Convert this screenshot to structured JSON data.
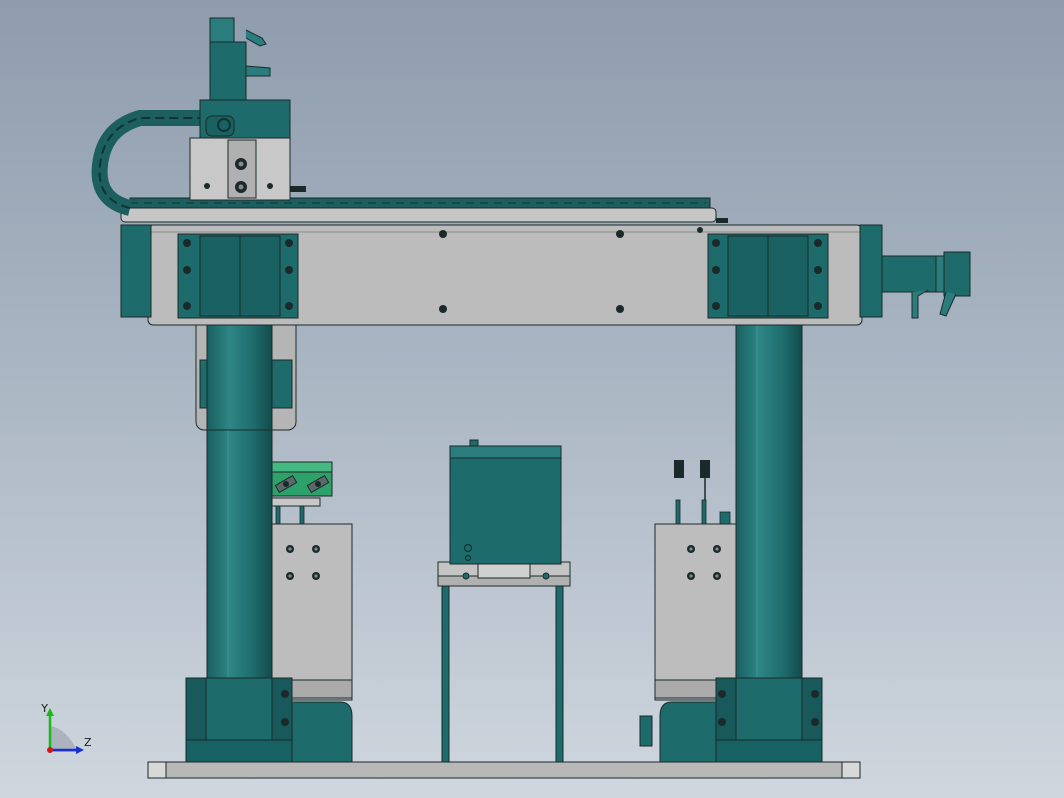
{
  "colors": {
    "teal": "#1e6b6b",
    "teal_dark": "#0f4446",
    "teal_light": "#2f8a88",
    "steel": "#b9b9b9",
    "steel_dark": "#8c8c8c",
    "edge": "#1a2a2a",
    "triad_x": "#d01818",
    "triad_y": "#18b818",
    "triad_z": "#1830d0"
  },
  "view_triad": {
    "y_label": "Y",
    "z_label": "Z"
  }
}
